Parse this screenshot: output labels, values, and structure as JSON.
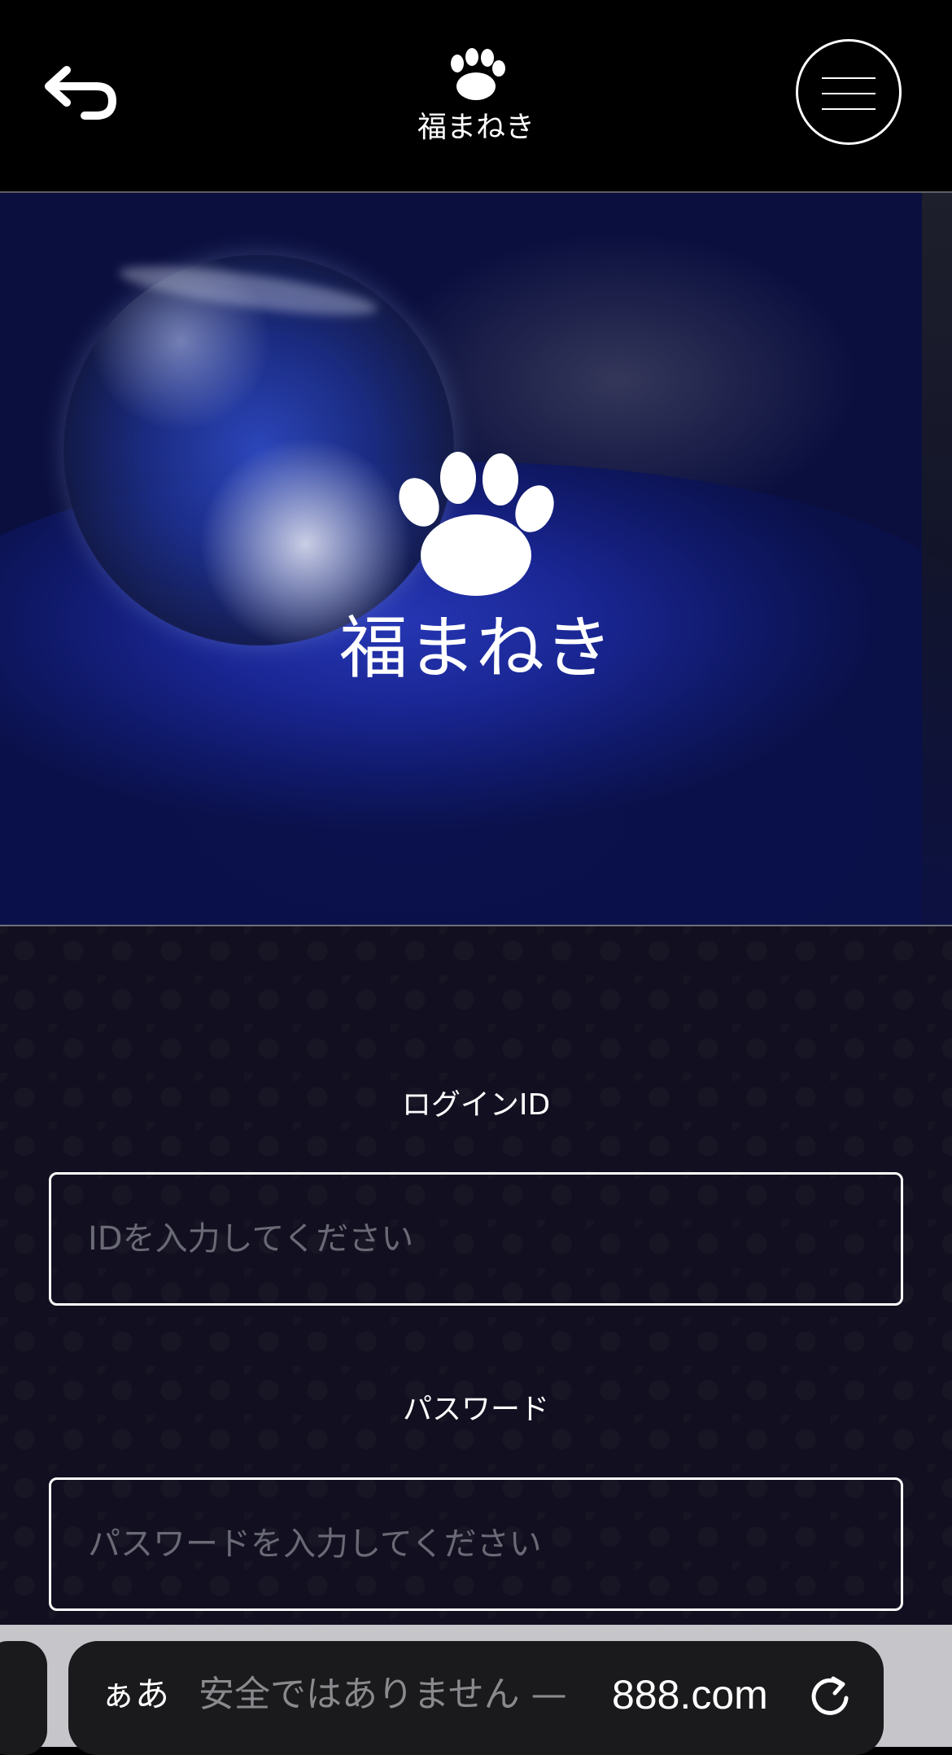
{
  "header": {
    "back_icon": "return-arrow-icon",
    "logo_text": "福まねき",
    "menu_icon": "hamburger-menu-icon"
  },
  "hero": {
    "logo_text": "福まねき"
  },
  "login_form": {
    "id_label": "ログインID",
    "id_placeholder": "IDを入力してください",
    "id_value": "",
    "password_label": "パスワード",
    "password_placeholder": "パスワードを入力してください",
    "password_value": ""
  },
  "browser": {
    "text_size_label": "ぁあ",
    "security_text": "安全ではありません —",
    "domain": "888.com",
    "reload_icon": "reload-icon"
  },
  "colors": {
    "page_background": "#000000",
    "form_background": "#121020",
    "placeholder": "#6a6a76",
    "browser_bar": "#c6c6ca",
    "address_pill": "#1a1a1c"
  }
}
